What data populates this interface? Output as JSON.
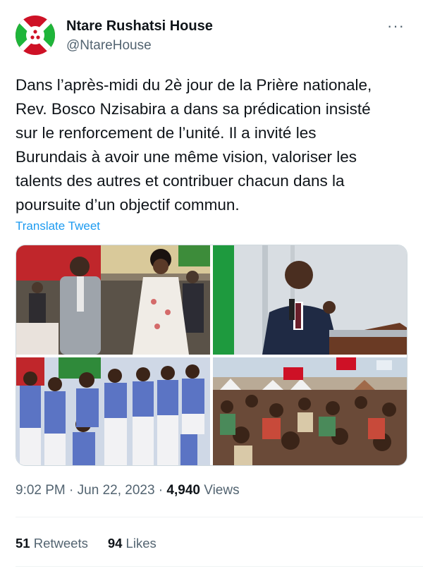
{
  "author": {
    "display_name": "Ntare Rushatsi House",
    "handle": "@NtareHouse",
    "avatar_icon": "burundi-flag-icon"
  },
  "more_icon": "ellipsis-icon",
  "more_label": "···",
  "tweet": {
    "text": "Dans l’après-midi du 2è jour de la Prière nationale,\nRev. Bosco Nzisabira a dans sa prédication insisté\nsur le renforcement de l’unité. Il a invité les\nBurundais à avoir une même vision, valoriser les\ntalents des autres et contribuer chacun dans la\npoursuite d’un objectif commun.",
    "translate_label": "Translate Tweet"
  },
  "media": [
    {
      "name": "photo-couple-praying",
      "alt": ""
    },
    {
      "name": "photo-preacher",
      "alt": ""
    },
    {
      "name": "photo-choir",
      "alt": ""
    },
    {
      "name": "photo-crowd",
      "alt": ""
    }
  ],
  "meta": {
    "time": "9:02 PM",
    "separator": " · ",
    "date": "Jun 22, 2023",
    "views_count": "4,940",
    "views_label": " Views"
  },
  "stats": {
    "retweets_count": "51",
    "retweets_label": " Retweets",
    "likes_count": "94",
    "likes_label": " Likes"
  },
  "colors": {
    "link": "#1d9bf0",
    "secondary_text": "#536471",
    "flag_red": "#ce1126",
    "flag_green": "#1eb53a"
  }
}
